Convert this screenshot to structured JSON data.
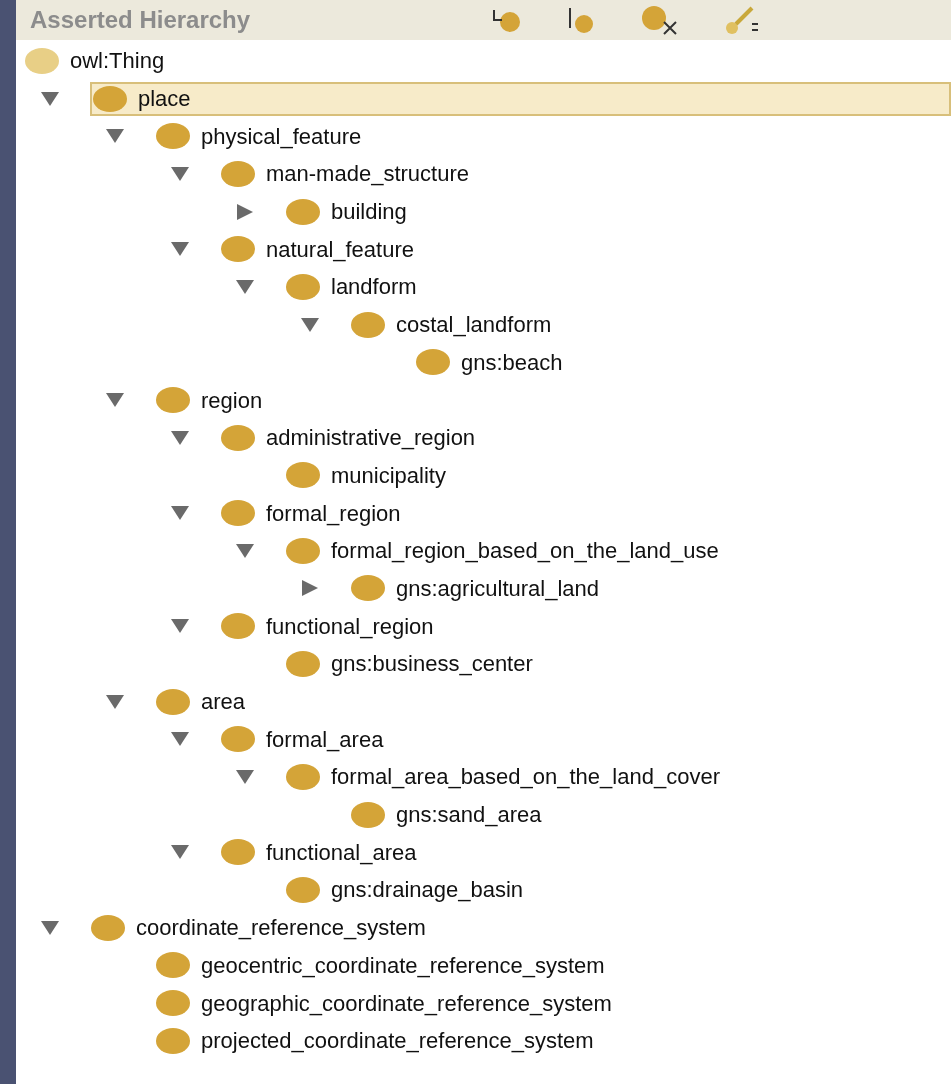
{
  "panel": {
    "title": "Asserted Hierarchy"
  },
  "tree": [
    {
      "label": "owl:Thing",
      "selected": false,
      "children": [
        {
          "label": "place",
          "selected": true,
          "expanded": true,
          "children": [
            {
              "label": "physical_feature",
              "selected": false,
              "expanded": true,
              "children": [
                {
                  "label": "man-made_structure",
                  "selected": false,
                  "expanded": true,
                  "children": [
                    {
                      "label": "building",
                      "selected": false,
                      "expanded": false
                    }
                  ]
                },
                {
                  "label": "natural_feature",
                  "selected": false,
                  "expanded": true,
                  "children": [
                    {
                      "label": "landform",
                      "selected": false,
                      "expanded": true,
                      "children": [
                        {
                          "label": "costal_landform",
                          "selected": false,
                          "expanded": true,
                          "children": [
                            {
                              "label": "gns:beach",
                              "selected": false
                            }
                          ]
                        }
                      ]
                    }
                  ]
                }
              ]
            },
            {
              "label": "region",
              "selected": false,
              "expanded": true,
              "children": [
                {
                  "label": "administrative_region",
                  "selected": false,
                  "expanded": true,
                  "children": [
                    {
                      "label": "municipality",
                      "selected": false
                    }
                  ]
                },
                {
                  "label": "formal_region",
                  "selected": false,
                  "expanded": true,
                  "children": [
                    {
                      "label": "formal_region_based_on_the_land_use",
                      "selected": false,
                      "expanded": true,
                      "children": [
                        {
                          "label": "gns:agricultural_land",
                          "selected": false,
                          "expanded": false
                        }
                      ]
                    }
                  ]
                },
                {
                  "label": "functional_region",
                  "selected": false,
                  "expanded": true,
                  "children": [
                    {
                      "label": "gns:business_center",
                      "selected": false
                    }
                  ]
                }
              ]
            },
            {
              "label": "area",
              "selected": false,
              "expanded": true,
              "children": [
                {
                  "label": "formal_area",
                  "selected": false,
                  "expanded": true,
                  "children": [
                    {
                      "label": "formal_area_based_on_the_land_cover",
                      "selected": false,
                      "expanded": true,
                      "children": [
                        {
                          "label": "gns:sand_area",
                          "selected": false
                        }
                      ]
                    }
                  ]
                },
                {
                  "label": "functional_area",
                  "selected": false,
                  "expanded": true,
                  "children": [
                    {
                      "label": "gns:drainage_basin",
                      "selected": false
                    }
                  ]
                }
              ]
            }
          ]
        },
        {
          "label": "coordinate_reference_system",
          "selected": false,
          "expanded": true,
          "children": [
            {
              "label": "geocentric_coordinate_reference_system",
              "selected": false
            },
            {
              "label": "geographic_coordinate_reference_system",
              "selected": false
            },
            {
              "label": "projected_coordinate_reference_system",
              "selected": false
            }
          ]
        }
      ]
    }
  ]
}
